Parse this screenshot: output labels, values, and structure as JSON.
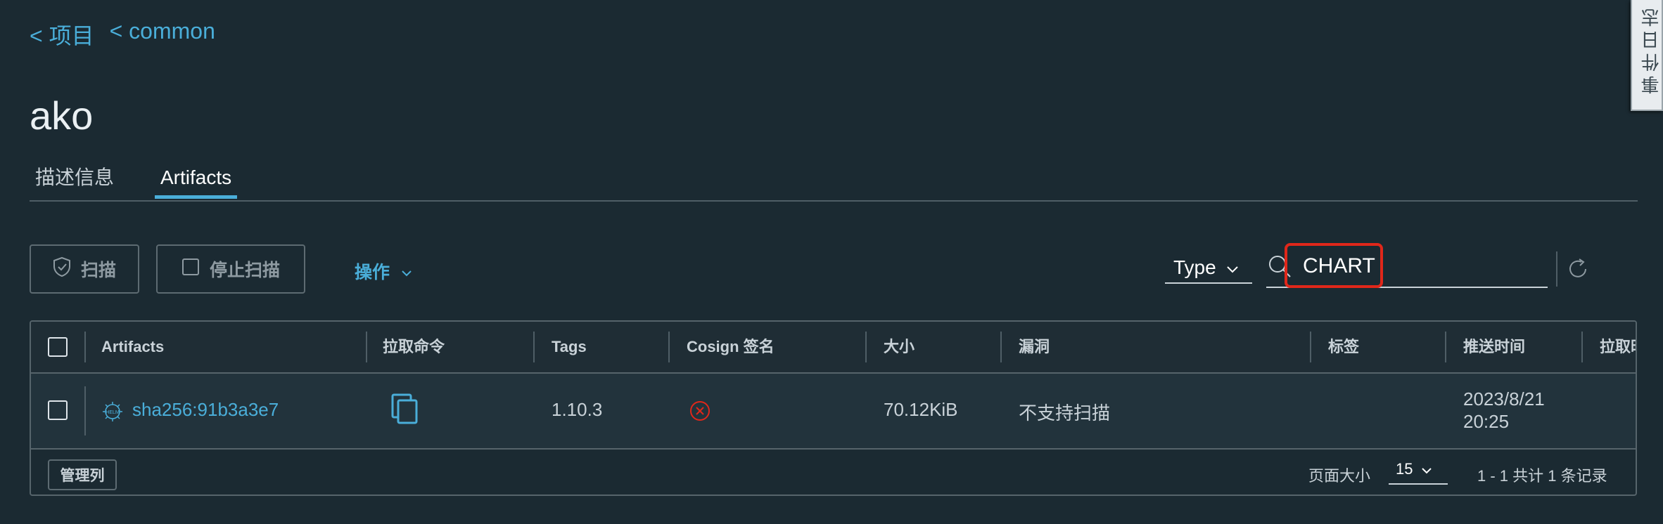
{
  "breadcrumb": [
    "< 项目",
    "< common"
  ],
  "page_title": "ako",
  "tabs": [
    "描述信息",
    "Artifacts"
  ],
  "toolbar": {
    "scan_label": "扫描",
    "stop_scan_label": "停止扫描",
    "actions_label": "操作"
  },
  "filter": {
    "type_label": "Type",
    "search_value": "CHART"
  },
  "table": {
    "headers": [
      "Artifacts",
      "拉取命令",
      "Tags",
      "Cosign 签名",
      "大小",
      "漏洞",
      "标签",
      "推送时间",
      "拉取时"
    ],
    "rows": [
      {
        "icon_text": "HELM",
        "artifact": "sha256:91b3a3e7",
        "tags": "1.10.3",
        "size": "70.12KiB",
        "vulnerabilities": "不支持扫描",
        "labels": "",
        "push_time_date": "2023/8/21",
        "push_time_time": "20:25"
      }
    ]
  },
  "footer": {
    "manage_columns": "管理列",
    "page_size_label": "页面大小",
    "page_size_value": "15",
    "summary": "1 - 1 共计 1 条记录"
  },
  "event_log": "事件日志",
  "colors": {
    "accent": "#4aaed9",
    "background": "#1b2a32",
    "error": "#e0271a"
  }
}
